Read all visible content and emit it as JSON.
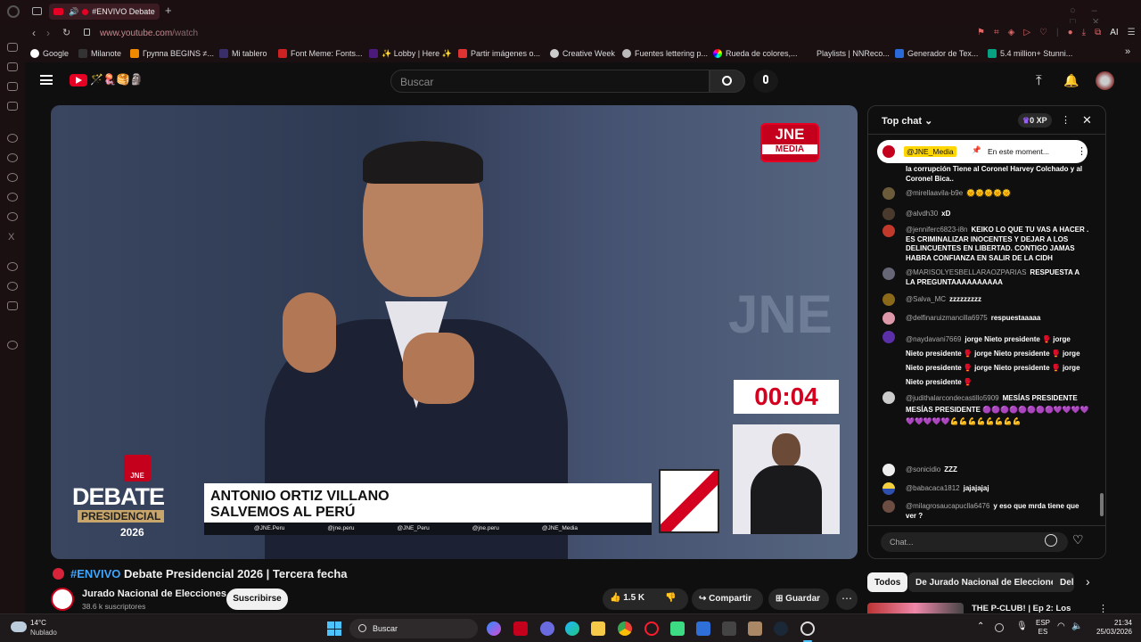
{
  "browser": {
    "tab_title": "#ENVIVO Debate Pr",
    "url_host": "www.youtube.com",
    "url_path": "/watch",
    "toolbar_ai": "AI",
    "bookmarks": [
      "Google",
      "Milanote",
      "Группа BEGINS ≠...",
      "Mi tablero",
      "Font Meme: Fonts...",
      "✨ Lobby | Here ✨",
      "Partir imágenes o...",
      "Creative Week",
      "Fuentes lettering p...",
      "Rueda de colores,...",
      "Playlists | NNReco...",
      "Generador de Tex...",
      "5.4 million+ Stunni..."
    ]
  },
  "youtube": {
    "search_placeholder": "Buscar",
    "logo_emoji": "🪄🪼🥞🗿"
  },
  "video": {
    "media_logo_top": "JNE",
    "media_logo_bottom": "MEDIA",
    "timer": "00:04",
    "bg_letters": "JNE",
    "debate_badge": "JNE",
    "debate_word": "DEBATE",
    "presidencial_word": "PRESIDENCIAL",
    "year": "2026",
    "candidate_name": "ANTONIO ORTIZ VILLANO",
    "candidate_party": "SALVEMOS AL PERÚ",
    "socials": [
      "@JNE.Peru",
      "@jne.peru",
      "@JNE_Peru",
      "@jne.peru",
      "@JNE_Media"
    ]
  },
  "chat": {
    "header_title": "Top chat",
    "xp": "0 XP",
    "pinned_author": "@JNE_Media",
    "pinned_text": "En este moment...",
    "overflow_text": "la corrupción Tiene al Coronel Harvey Colchado y al Coronel Bica..",
    "messages": [
      {
        "author": "@mirellaavila-b9e",
        "text": "🌞🌞🌞🌞🌞"
      },
      {
        "author": "@alvdh30",
        "text": "xD"
      },
      {
        "author": "@jenniferc6823-i8n",
        "text": "KEIKO LO QUE TU VAS A HACER . ES CRIMINALIZAR INOCENTES Y DEJAR A LOS DELINCUENTES EN LIBERTAD. CONTIGO JAMAS HABRA CONFIANZA EN SALIR DE LA CIDH"
      },
      {
        "author": "@MARISOLYESBELLARAOZPARIAS",
        "text": "RESPUESTA A LA PREGUNTAAAAAAAAAA"
      },
      {
        "author": "@Salva_MC",
        "text": "zzzzzzzzz"
      },
      {
        "author": "@delfinaruizmancilla6975",
        "text": "respuestaaaaa"
      },
      {
        "author": "@naydavani7669",
        "text": "jorge Nieto presidente 🥊 jorge Nieto presidente 🥊 jorge Nieto presidente 🥊 jorge Nieto presidente 🥊 jorge Nieto presidente 🥊 jorge Nieto presidente 🥊"
      },
      {
        "author": "@judithalarcondecastillo5909",
        "text": "MESÍAS PRESIDENTE MESÍAS PRESIDENTE 🟣🟣🟣🟣🟣🟣🟣🟣💜💜💜💜💜💜💜💜💜💪💪💪💪💪💪💪💪"
      },
      {
        "author": "@sonicidio",
        "text": "ZZZ"
      },
      {
        "author": "@babacaca1812",
        "text": "jajajajaj"
      },
      {
        "author": "@milagrosaucapuclla6476",
        "text": "y eso que mrda tiene que ver ?"
      }
    ],
    "input_placeholder": "Chat..."
  },
  "below": {
    "live_tag": "#ENVIVO",
    "title_rest": "Debate Presidencial 2026 | Tercera fecha",
    "channel_name": "Jurado Nacional de Elecciones",
    "subscribers": "38.6 k suscriptores",
    "subscribe_label": "Suscribirse",
    "likes": "1.5 K",
    "share_label": "Compartir",
    "save_label": "Guardar",
    "chips": [
      "Todos",
      "De Jurado Nacional de Elecciones",
      "Del"
    ],
    "rec_title": "THE P-CLUB! | Ep 2: Los"
  },
  "taskbar": {
    "weather_temp": "14°C",
    "weather_desc": "Nublado",
    "search_label": "Buscar",
    "lang1": "ESP",
    "lang2": "ES",
    "time": "21:34",
    "date": "25/03/2026"
  },
  "colors": {
    "accent_red": "#e60023",
    "chat_bg": "#0f0f0f",
    "tab_bg": "#3a1c22"
  }
}
